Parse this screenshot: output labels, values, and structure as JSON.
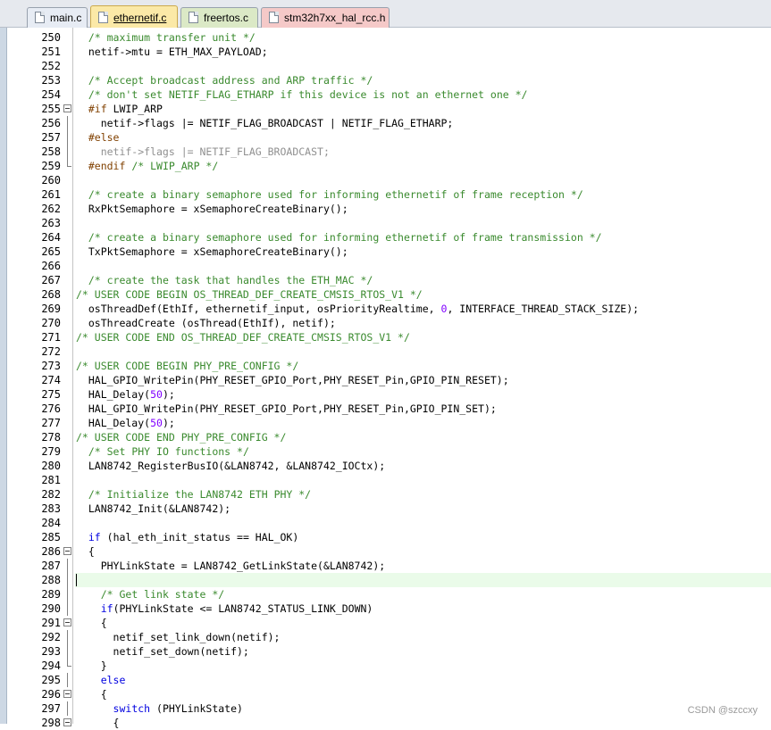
{
  "tabs": [
    {
      "label": "main.c"
    },
    {
      "label": "ethernetif.c",
      "active": true
    },
    {
      "label": "freertos.c"
    },
    {
      "label": "stm32h7xx_hal_rcc.h"
    }
  ],
  "current_line": "288",
  "watermark": "CSDN @szccxy",
  "lines": [
    {
      "n": "250",
      "fold": "",
      "parts": [
        {
          "t": "  ",
          "c": ""
        },
        {
          "t": "/* maximum transfer unit */",
          "c": "comment"
        }
      ]
    },
    {
      "n": "251",
      "fold": "",
      "parts": [
        {
          "t": "  netif->mtu = ETH_MAX_PAYLOAD;",
          "c": ""
        }
      ]
    },
    {
      "n": "252",
      "fold": "",
      "parts": []
    },
    {
      "n": "253",
      "fold": "",
      "parts": [
        {
          "t": "  ",
          "c": ""
        },
        {
          "t": "/* Accept broadcast address and ARP traffic */",
          "c": "comment"
        }
      ]
    },
    {
      "n": "254",
      "fold": "",
      "parts": [
        {
          "t": "  ",
          "c": ""
        },
        {
          "t": "/* don't set NETIF_FLAG_ETHARP if this device is not an ethernet one */",
          "c": "comment"
        }
      ]
    },
    {
      "n": "255",
      "fold": "box",
      "parts": [
        {
          "t": "  ",
          "c": ""
        },
        {
          "t": "#if",
          "c": "pre"
        },
        {
          "t": " LWIP_ARP",
          "c": ""
        }
      ]
    },
    {
      "n": "256",
      "fold": "vl",
      "parts": [
        {
          "t": "    netif->flags |= NETIF_FLAG_BROADCAST | NETIF_FLAG_ETHARP;",
          "c": ""
        }
      ]
    },
    {
      "n": "257",
      "fold": "vl",
      "parts": [
        {
          "t": "  ",
          "c": ""
        },
        {
          "t": "#else",
          "c": "pre"
        }
      ]
    },
    {
      "n": "258",
      "fold": "vl",
      "parts": [
        {
          "t": "    netif->flags |= NETIF_FLAG_BROADCAST;",
          "c": "dis"
        }
      ]
    },
    {
      "n": "259",
      "fold": "end",
      "parts": [
        {
          "t": "  ",
          "c": ""
        },
        {
          "t": "#endif",
          "c": "pre"
        },
        {
          "t": " /* LWIP_ARP */",
          "c": "comment"
        }
      ]
    },
    {
      "n": "260",
      "fold": "",
      "parts": []
    },
    {
      "n": "261",
      "fold": "",
      "parts": [
        {
          "t": "  ",
          "c": ""
        },
        {
          "t": "/* create a binary semaphore used for informing ethernetif of frame reception */",
          "c": "comment"
        }
      ]
    },
    {
      "n": "262",
      "fold": "",
      "parts": [
        {
          "t": "  RxPktSemaphore = xSemaphoreCreateBinary();",
          "c": ""
        }
      ]
    },
    {
      "n": "263",
      "fold": "",
      "parts": []
    },
    {
      "n": "264",
      "fold": "",
      "parts": [
        {
          "t": "  ",
          "c": ""
        },
        {
          "t": "/* create a binary semaphore used for informing ethernetif of frame transmission */",
          "c": "comment"
        }
      ]
    },
    {
      "n": "265",
      "fold": "",
      "parts": [
        {
          "t": "  TxPktSemaphore = xSemaphoreCreateBinary();",
          "c": ""
        }
      ]
    },
    {
      "n": "266",
      "fold": "",
      "parts": []
    },
    {
      "n": "267",
      "fold": "",
      "parts": [
        {
          "t": "  ",
          "c": ""
        },
        {
          "t": "/* create the task that handles the ETH_MAC */",
          "c": "comment"
        }
      ]
    },
    {
      "n": "268",
      "fold": "",
      "parts": [
        {
          "t": "/* USER CODE BEGIN OS_THREAD_DEF_CREATE_CMSIS_RTOS_V1 */",
          "c": "comment"
        }
      ]
    },
    {
      "n": "269",
      "fold": "",
      "parts": [
        {
          "t": "  osThreadDef(EthIf, ethernetif_input, osPriorityRealtime, ",
          "c": ""
        },
        {
          "t": "0",
          "c": "num"
        },
        {
          "t": ", INTERFACE_THREAD_STACK_SIZE);",
          "c": ""
        }
      ]
    },
    {
      "n": "270",
      "fold": "",
      "parts": [
        {
          "t": "  osThreadCreate (osThread(EthIf), netif);",
          "c": ""
        }
      ]
    },
    {
      "n": "271",
      "fold": "",
      "parts": [
        {
          "t": "/* USER CODE END OS_THREAD_DEF_CREATE_CMSIS_RTOS_V1 */",
          "c": "comment"
        }
      ]
    },
    {
      "n": "272",
      "fold": "",
      "parts": []
    },
    {
      "n": "273",
      "fold": "",
      "parts": [
        {
          "t": "/* USER CODE BEGIN PHY_PRE_CONFIG */",
          "c": "comment"
        }
      ]
    },
    {
      "n": "274",
      "fold": "",
      "parts": [
        {
          "t": "  HAL_GPIO_WritePin(PHY_RESET_GPIO_Port,PHY_RESET_Pin,GPIO_PIN_RESET);",
          "c": ""
        }
      ]
    },
    {
      "n": "275",
      "fold": "",
      "parts": [
        {
          "t": "  HAL_Delay(",
          "c": ""
        },
        {
          "t": "50",
          "c": "num"
        },
        {
          "t": ");",
          "c": ""
        }
      ]
    },
    {
      "n": "276",
      "fold": "",
      "parts": [
        {
          "t": "  HAL_GPIO_WritePin(PHY_RESET_GPIO_Port,PHY_RESET_Pin,GPIO_PIN_SET);",
          "c": ""
        }
      ]
    },
    {
      "n": "277",
      "fold": "",
      "parts": [
        {
          "t": "  HAL_Delay(",
          "c": ""
        },
        {
          "t": "50",
          "c": "num"
        },
        {
          "t": ");",
          "c": ""
        }
      ]
    },
    {
      "n": "278",
      "fold": "",
      "parts": [
        {
          "t": "/* USER CODE END PHY_PRE_CONFIG */",
          "c": "comment"
        }
      ]
    },
    {
      "n": "279",
      "fold": "",
      "parts": [
        {
          "t": "  ",
          "c": ""
        },
        {
          "t": "/* Set PHY IO functions */",
          "c": "comment"
        }
      ]
    },
    {
      "n": "280",
      "fold": "",
      "parts": [
        {
          "t": "  LAN8742_RegisterBusIO(&LAN8742, &LAN8742_IOCtx);",
          "c": ""
        }
      ]
    },
    {
      "n": "281",
      "fold": "",
      "parts": []
    },
    {
      "n": "282",
      "fold": "",
      "parts": [
        {
          "t": "  ",
          "c": ""
        },
        {
          "t": "/* Initialize the LAN8742 ETH PHY */",
          "c": "comment"
        }
      ]
    },
    {
      "n": "283",
      "fold": "",
      "parts": [
        {
          "t": "  LAN8742_Init(&LAN8742);",
          "c": ""
        }
      ]
    },
    {
      "n": "284",
      "fold": "",
      "parts": []
    },
    {
      "n": "285",
      "fold": "",
      "parts": [
        {
          "t": "  ",
          "c": ""
        },
        {
          "t": "if",
          "c": "kw"
        },
        {
          "t": " (hal_eth_init_status == HAL_OK)",
          "c": ""
        }
      ]
    },
    {
      "n": "286",
      "fold": "box",
      "parts": [
        {
          "t": "  {",
          "c": ""
        }
      ]
    },
    {
      "n": "287",
      "fold": "vl",
      "parts": [
        {
          "t": "    PHYLinkState = LAN8742_GetLinkState(&LAN8742);",
          "c": ""
        }
      ]
    },
    {
      "n": "288",
      "fold": "vl",
      "parts": []
    },
    {
      "n": "289",
      "fold": "vl",
      "parts": [
        {
          "t": "    ",
          "c": ""
        },
        {
          "t": "/* Get link state */",
          "c": "comment"
        }
      ]
    },
    {
      "n": "290",
      "fold": "vl",
      "parts": [
        {
          "t": "    ",
          "c": ""
        },
        {
          "t": "if",
          "c": "kw"
        },
        {
          "t": "(PHYLinkState <= LAN8742_STATUS_LINK_DOWN)",
          "c": ""
        }
      ]
    },
    {
      "n": "291",
      "fold": "box",
      "parts": [
        {
          "t": "    {",
          "c": ""
        }
      ]
    },
    {
      "n": "292",
      "fold": "vl",
      "parts": [
        {
          "t": "      netif_set_link_down(netif);",
          "c": ""
        }
      ]
    },
    {
      "n": "293",
      "fold": "vl",
      "parts": [
        {
          "t": "      netif_set_down(netif);",
          "c": ""
        }
      ]
    },
    {
      "n": "294",
      "fold": "end",
      "parts": [
        {
          "t": "    }",
          "c": ""
        }
      ]
    },
    {
      "n": "295",
      "fold": "vl",
      "parts": [
        {
          "t": "    ",
          "c": ""
        },
        {
          "t": "else",
          "c": "kw"
        }
      ]
    },
    {
      "n": "296",
      "fold": "box",
      "parts": [
        {
          "t": "    {",
          "c": ""
        }
      ]
    },
    {
      "n": "297",
      "fold": "vl",
      "parts": [
        {
          "t": "      ",
          "c": ""
        },
        {
          "t": "switch",
          "c": "kw"
        },
        {
          "t": " (PHYLinkState)",
          "c": ""
        }
      ]
    },
    {
      "n": "298",
      "fold": "box",
      "parts": [
        {
          "t": "      {",
          "c": ""
        }
      ]
    }
  ]
}
